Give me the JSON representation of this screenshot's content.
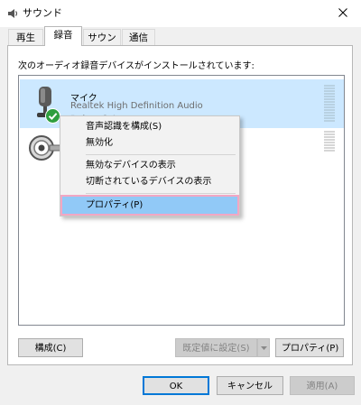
{
  "window": {
    "title": "サウンド"
  },
  "tabs": [
    {
      "label": "再生",
      "active": false
    },
    {
      "label": "録音",
      "active": true
    },
    {
      "label": "サウンド",
      "active": false
    },
    {
      "label": "通信",
      "active": false
    }
  ],
  "recording": {
    "instruction": "次のオーディオ録音デバイスがインストールされています:",
    "devices": [
      {
        "name": "マイク",
        "description": "Realtek High Definition Audio",
        "status": "既定のデバイス",
        "selected": true,
        "default": true
      },
      {
        "name": "",
        "description": "",
        "status": "",
        "selected": false,
        "default": false
      }
    ]
  },
  "context_menu": {
    "items": [
      {
        "label": "音声認識を構成(S)",
        "highlighted": false
      },
      {
        "label": "無効化",
        "highlighted": false
      },
      {
        "label": "無効なデバイスの表示",
        "highlighted": false
      },
      {
        "label": "切断されているデバイスの表示",
        "highlighted": false
      },
      {
        "label": "プロパティ(P)",
        "highlighted": true
      }
    ]
  },
  "buttons": {
    "configure": "構成(C)",
    "set_default": "既定値に設定(S)",
    "properties": "プロパティ(P)",
    "ok": "OK",
    "cancel": "キャンセル",
    "apply": "適用(A)"
  },
  "colors": {
    "selection": "#cce8ff",
    "menu_highlight": "#91c9f7",
    "annotation_outline": "#f2a7c3",
    "default_check": "#2e9e3e"
  }
}
